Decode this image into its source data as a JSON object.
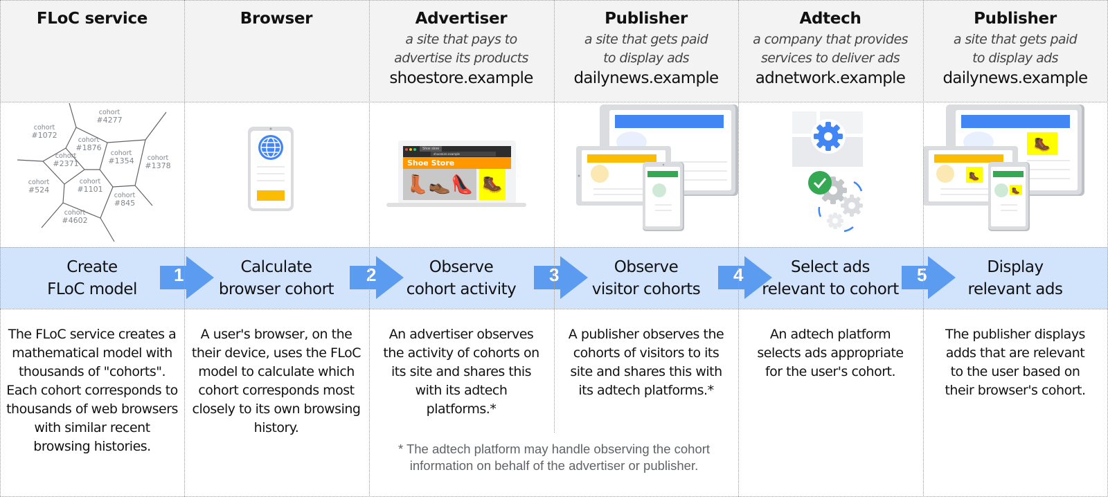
{
  "columns": [
    {
      "title": "FLoC service",
      "subtitle": "",
      "domain": "",
      "step_label_line1": "Create",
      "step_label_line2": "FLoC model",
      "description": "The FLoC service creates a mathematical model with thousands of \"cohorts\". Each cohort corresponds to thousands of web browsers with similar recent browsing histories."
    },
    {
      "title": "Browser",
      "subtitle": "",
      "domain": "",
      "step_label_line1": "Calculate",
      "step_label_line2": "browser cohort",
      "description": "A user's browser, on the their device, uses the FLoC model to calculate which cohort corresponds most closely to its own browsing history."
    },
    {
      "title": "Advertiser",
      "subtitle_line1": "a site that pays to",
      "subtitle_line2": "advertise its products",
      "domain": "shoestore.example",
      "step_label_line1": "Observe",
      "step_label_line2": "cohort activity",
      "description": "An advertiser observes the activity of cohorts on its site and shares this with its adtech platforms.*"
    },
    {
      "title": "Publisher",
      "subtitle_line1": "a site that gets paid",
      "subtitle_line2": "to display ads",
      "domain": "dailynews.example",
      "step_label_line1": "Observe",
      "step_label_line2": "visitor cohorts",
      "description": "A publisher observes the cohorts of visitors to its site and shares this with its adtech platforms.*"
    },
    {
      "title": "Adtech",
      "subtitle_line1": "a company that provides",
      "subtitle_line2": "services to deliver ads",
      "domain": "adnetwork.example",
      "step_label_line1": "Select ads",
      "step_label_line2": "relevant to cohort",
      "description": "An adtech platform selects ads appropriate for the user's cohort."
    },
    {
      "title": "Publisher",
      "subtitle_line1": "a site that gets paid",
      "subtitle_line2": "to display ads",
      "domain": "dailynews.example",
      "step_label_line1": "Display",
      "step_label_line2": "relevant ads",
      "description": "The publisher displays adds that are relevant to the user based on their browser's cohort."
    }
  ],
  "arrows": [
    "1",
    "2",
    "3",
    "4",
    "5"
  ],
  "cohorts": [
    {
      "label": "cohort",
      "id": "#4277"
    },
    {
      "label": "cohort",
      "id": "#1072"
    },
    {
      "label": "cohort",
      "id": "#1876"
    },
    {
      "label": "cohort",
      "id": "#2371"
    },
    {
      "label": "cohort",
      "id": "#1354"
    },
    {
      "label": "cohort",
      "id": "#1378"
    },
    {
      "label": "cohort",
      "id": "#524"
    },
    {
      "label": "cohort",
      "id": "#1101"
    },
    {
      "label": "cohort",
      "id": "#845"
    },
    {
      "label": "cohort",
      "id": "#4602"
    }
  ],
  "shoestore_illustration": {
    "tab_label": "Shoe store",
    "url": "shoestore.example",
    "banner": "Shoe Store"
  },
  "footnote_line1": "* The adtech platform may handle observing the cohort",
  "footnote_line2": "information on behalf of the advertiser or publisher.",
  "colors": {
    "header_bg": "#f3f3f3",
    "step_band_bg": "#d2e3fc",
    "arrow_blue": "#5b9cf0",
    "google_blue": "#4285f4",
    "google_yellow": "#fbbc04",
    "google_green": "#34a853",
    "shoe_orange": "#ff9800",
    "ad_yellow": "#ffff00"
  }
}
